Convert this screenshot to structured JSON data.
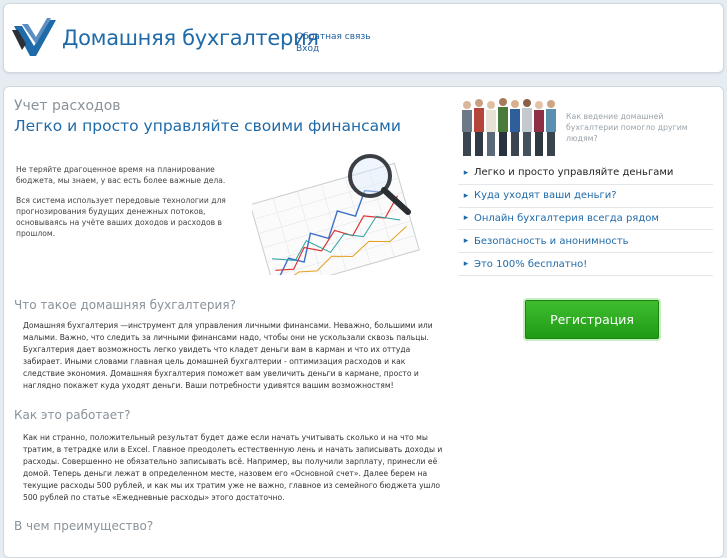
{
  "header": {
    "logo_text": "Домашняя бухгалтерия",
    "links": [
      "Обратная связь",
      "Вход"
    ]
  },
  "hero": {
    "section_label": "Учет расходов",
    "title": "Легко и просто управляйте своими финансами",
    "paragraphs": [
      "Не теряйте драгоценное время на планирование бюджета, мы знаем, у вас есть более важные дела.",
      "Вся система использует передовые технологии для прогнозирования будущих денежных потоков, основываясь на учёте ваших доходов и расходов в прошлом."
    ]
  },
  "aside": {
    "people_caption": "Как ведение домашней бухгалтерии помогло другим людям?",
    "features": [
      "Легко и просто управляйте деньгами",
      "Куда уходят ваши деньги?",
      "Онлайн бухгалтерия всегда рядом",
      "Безопасность и анонимность",
      "Это 100% бесплатно!"
    ],
    "register_label": "Регистрация"
  },
  "sections": [
    {
      "title": "Что такое домашняя бухгалтерия?",
      "text": "Домашняя бухгалтерия —инструмент для управления личными финансами. Неважно, большими или малыми. Важно, что следить за личными финансами надо, чтобы они не ускользали сквозь пальцы. Бухгалтерия дает возможность легко увидеть что кладет деньги вам в карман и что их оттуда забирает. Иными словами главная цель домашней бухгалтерии - оптимизация расходов и как следствие экономия. Домашняя бухгалтерия поможет вам увеличить деньги в кармане, просто и наглядно покажет куда уходят деньги. Ваши потребности удивятся вашим возможностям!"
    },
    {
      "title": "Как это работает?",
      "text": "Как ни странно, положительный результат будет даже если начать учитывать сколько и на что мы тратим, в тетрадке или в Excel. Главное преодолеть естественную лень и начать записывать доходы и расходы. Совершенно не обязательно записывать всё. Например, вы получили зарплату, принесли её домой. Теперь деньги лежат в определенном месте, назовем его «Основной счет». Далее берем на текущие расходы 500 рублей, и как мы их тратим уже не важно, главное из семейного бюджета ушло 500 рублей по статье «Ежедневные расходы» этого достаточно."
    },
    {
      "title": "В чем преимущество?",
      "text": ""
    }
  ]
}
